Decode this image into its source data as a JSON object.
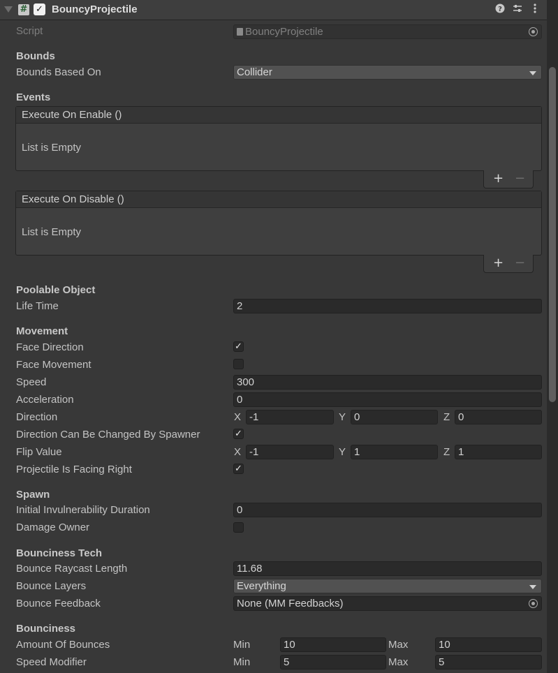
{
  "component": {
    "title": "BouncyProjectile",
    "enabled": true
  },
  "script": {
    "label": "Script",
    "value": "BouncyProjectile"
  },
  "bounds": {
    "header": "Bounds",
    "based_on_label": "Bounds Based On",
    "based_on_value": "Collider"
  },
  "events": {
    "header": "Events",
    "on_enable": {
      "title": "Execute On Enable ()",
      "empty": "List is Empty"
    },
    "on_disable": {
      "title": "Execute On Disable ()",
      "empty": "List is Empty"
    },
    "add": "+",
    "remove": "−"
  },
  "poolable": {
    "header": "Poolable Object",
    "life_time_label": "Life Time",
    "life_time": "2"
  },
  "movement": {
    "header": "Movement",
    "face_direction_label": "Face Direction",
    "face_direction": true,
    "face_movement_label": "Face Movement",
    "face_movement": false,
    "speed_label": "Speed",
    "speed": "300",
    "acceleration_label": "Acceleration",
    "acceleration": "0",
    "direction_label": "Direction",
    "direction": {
      "x": "-1",
      "y": "0",
      "z": "0"
    },
    "dir_changed_label": "Direction Can Be Changed By Spawner",
    "dir_changed": true,
    "flip_label": "Flip Value",
    "flip": {
      "x": "-1",
      "y": "1",
      "z": "1"
    },
    "facing_right_label": "Projectile Is Facing Right",
    "facing_right": true
  },
  "axes": {
    "x": "X",
    "y": "Y",
    "z": "Z"
  },
  "spawn": {
    "header": "Spawn",
    "invuln_label": "Initial Invulnerability Duration",
    "invuln": "0",
    "damage_owner_label": "Damage Owner",
    "damage_owner": false
  },
  "tech": {
    "header": "Bounciness Tech",
    "raycast_label": "Bounce Raycast Length",
    "raycast": "11.68",
    "layers_label": "Bounce Layers",
    "layers": "Everything",
    "feedback_label": "Bounce Feedback",
    "feedback": "None (MM Feedbacks)"
  },
  "bounciness": {
    "header": "Bounciness",
    "min_label": "Min",
    "max_label": "Max",
    "amount_label": "Amount Of Bounces",
    "amount_min": "10",
    "amount_max": "10",
    "speed_mod_label": "Speed Modifier",
    "speed_min": "5",
    "speed_max": "5"
  },
  "check_glyph": "✓",
  "icons": {
    "help": "help-icon",
    "presets": "presets-icon",
    "menu": "kebab-menu-icon",
    "script": "script-icon",
    "object_picker": "object-picker-icon"
  }
}
